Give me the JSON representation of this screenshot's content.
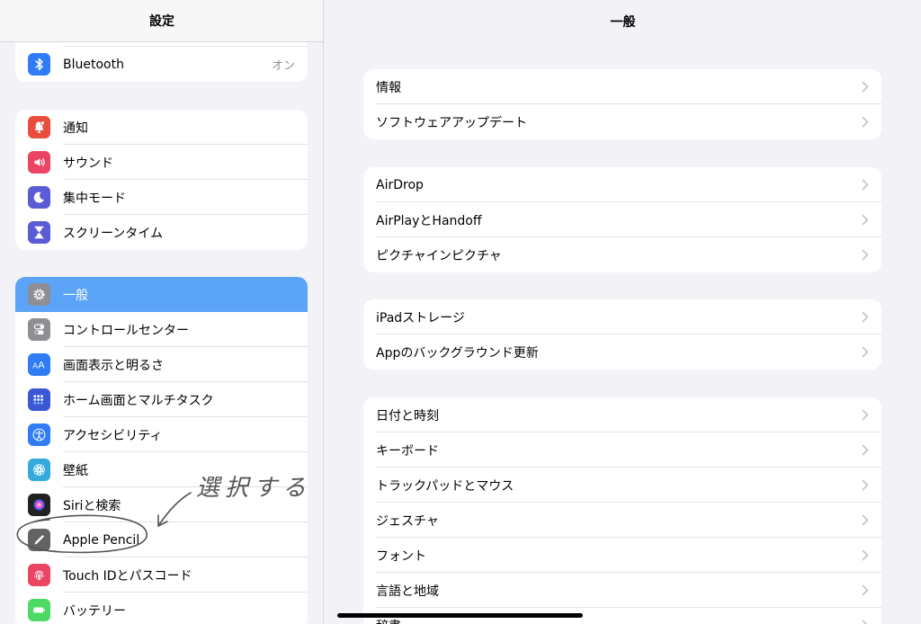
{
  "sidebar": {
    "title": "設定",
    "groups": [
      [
        {
          "label": "Bluetooth",
          "value": "オン",
          "icon": "bluetooth-icon",
          "color": "#2f7cf6"
        }
      ],
      [
        {
          "label": "通知",
          "icon": "bell-icon",
          "color": "#eb4d3d"
        },
        {
          "label": "サウンド",
          "icon": "speaker-icon",
          "color": "#eb4563"
        },
        {
          "label": "集中モード",
          "icon": "moon-icon",
          "color": "#5b5bd6"
        },
        {
          "label": "スクリーンタイム",
          "icon": "hourglass-icon",
          "color": "#5b5bd6"
        }
      ],
      [
        {
          "label": "一般",
          "icon": "gear-icon",
          "color": "#8e8e93",
          "selected": true
        },
        {
          "label": "コントロールセンター",
          "icon": "toggles-icon",
          "color": "#8e8e93"
        },
        {
          "label": "画面表示と明るさ",
          "icon": "text-size-icon",
          "color": "#2f7cf6"
        },
        {
          "label": "ホーム画面とマルチタスク",
          "icon": "grid-icon",
          "color": "#3a58d6"
        },
        {
          "label": "アクセシビリティ",
          "icon": "accessibility-icon",
          "color": "#2f7cf6"
        },
        {
          "label": "壁紙",
          "icon": "flower-icon",
          "color": "#35aadc"
        },
        {
          "label": "Siriと検索",
          "icon": "siri-icon",
          "color": "#222222"
        },
        {
          "label": "Apple Pencil",
          "icon": "pencil-icon",
          "color": "#636366"
        },
        {
          "label": "Touch IDとパスコード",
          "icon": "fingerprint-icon",
          "color": "#eb4563"
        },
        {
          "label": "バッテリー",
          "icon": "battery-icon",
          "color": "#4cd964"
        }
      ]
    ]
  },
  "main": {
    "title": "一般",
    "groups": [
      [
        "情報",
        "ソフトウェアアップデート"
      ],
      [
        "AirDrop",
        "AirPlayとHandoff",
        "ピクチャインピクチャ"
      ],
      [
        "iPadストレージ",
        "Appのバックグラウンド更新"
      ],
      [
        "日付と時刻",
        "キーボード",
        "トラックパッドとマウス",
        "ジェスチャ",
        "フォント",
        "言語と地域",
        "辞書"
      ]
    ]
  },
  "annotation": {
    "text": "選択する",
    "color": "#555555"
  },
  "colors": {
    "selected": "#5ba4f7",
    "chevron": "#c4c4c7",
    "background": "#f2f2f7"
  }
}
